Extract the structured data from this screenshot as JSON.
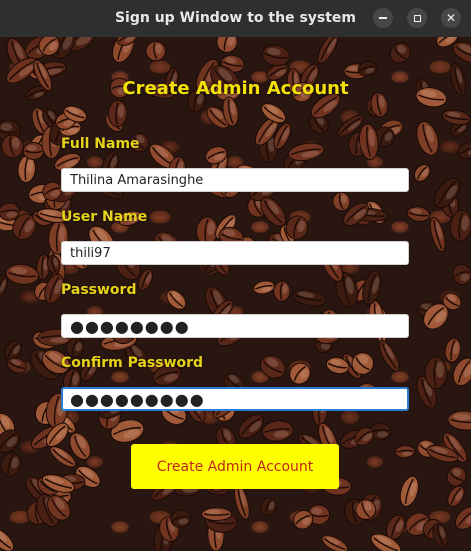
{
  "window": {
    "title": "Sign up Window to the system",
    "controls": [
      "minimize-icon",
      "maximize-icon",
      "close-icon"
    ]
  },
  "form": {
    "heading": "Create Admin Account",
    "full_name": {
      "label": "Full Name",
      "value": "Thilina Amarasinghe"
    },
    "user_name": {
      "label": "User Name",
      "value": "thili97"
    },
    "password": {
      "label": "Password",
      "value": "●●●●●●●●"
    },
    "confirm_password": {
      "label": "Confirm Password",
      "value": "●●●●●●●●●"
    },
    "submit_label": "Create Admin Account"
  },
  "colors": {
    "label_yellow": "#e6d31a",
    "button_yellow": "#ffff00",
    "button_text": "#c0261b",
    "focus_border": "#2a7fd4"
  }
}
